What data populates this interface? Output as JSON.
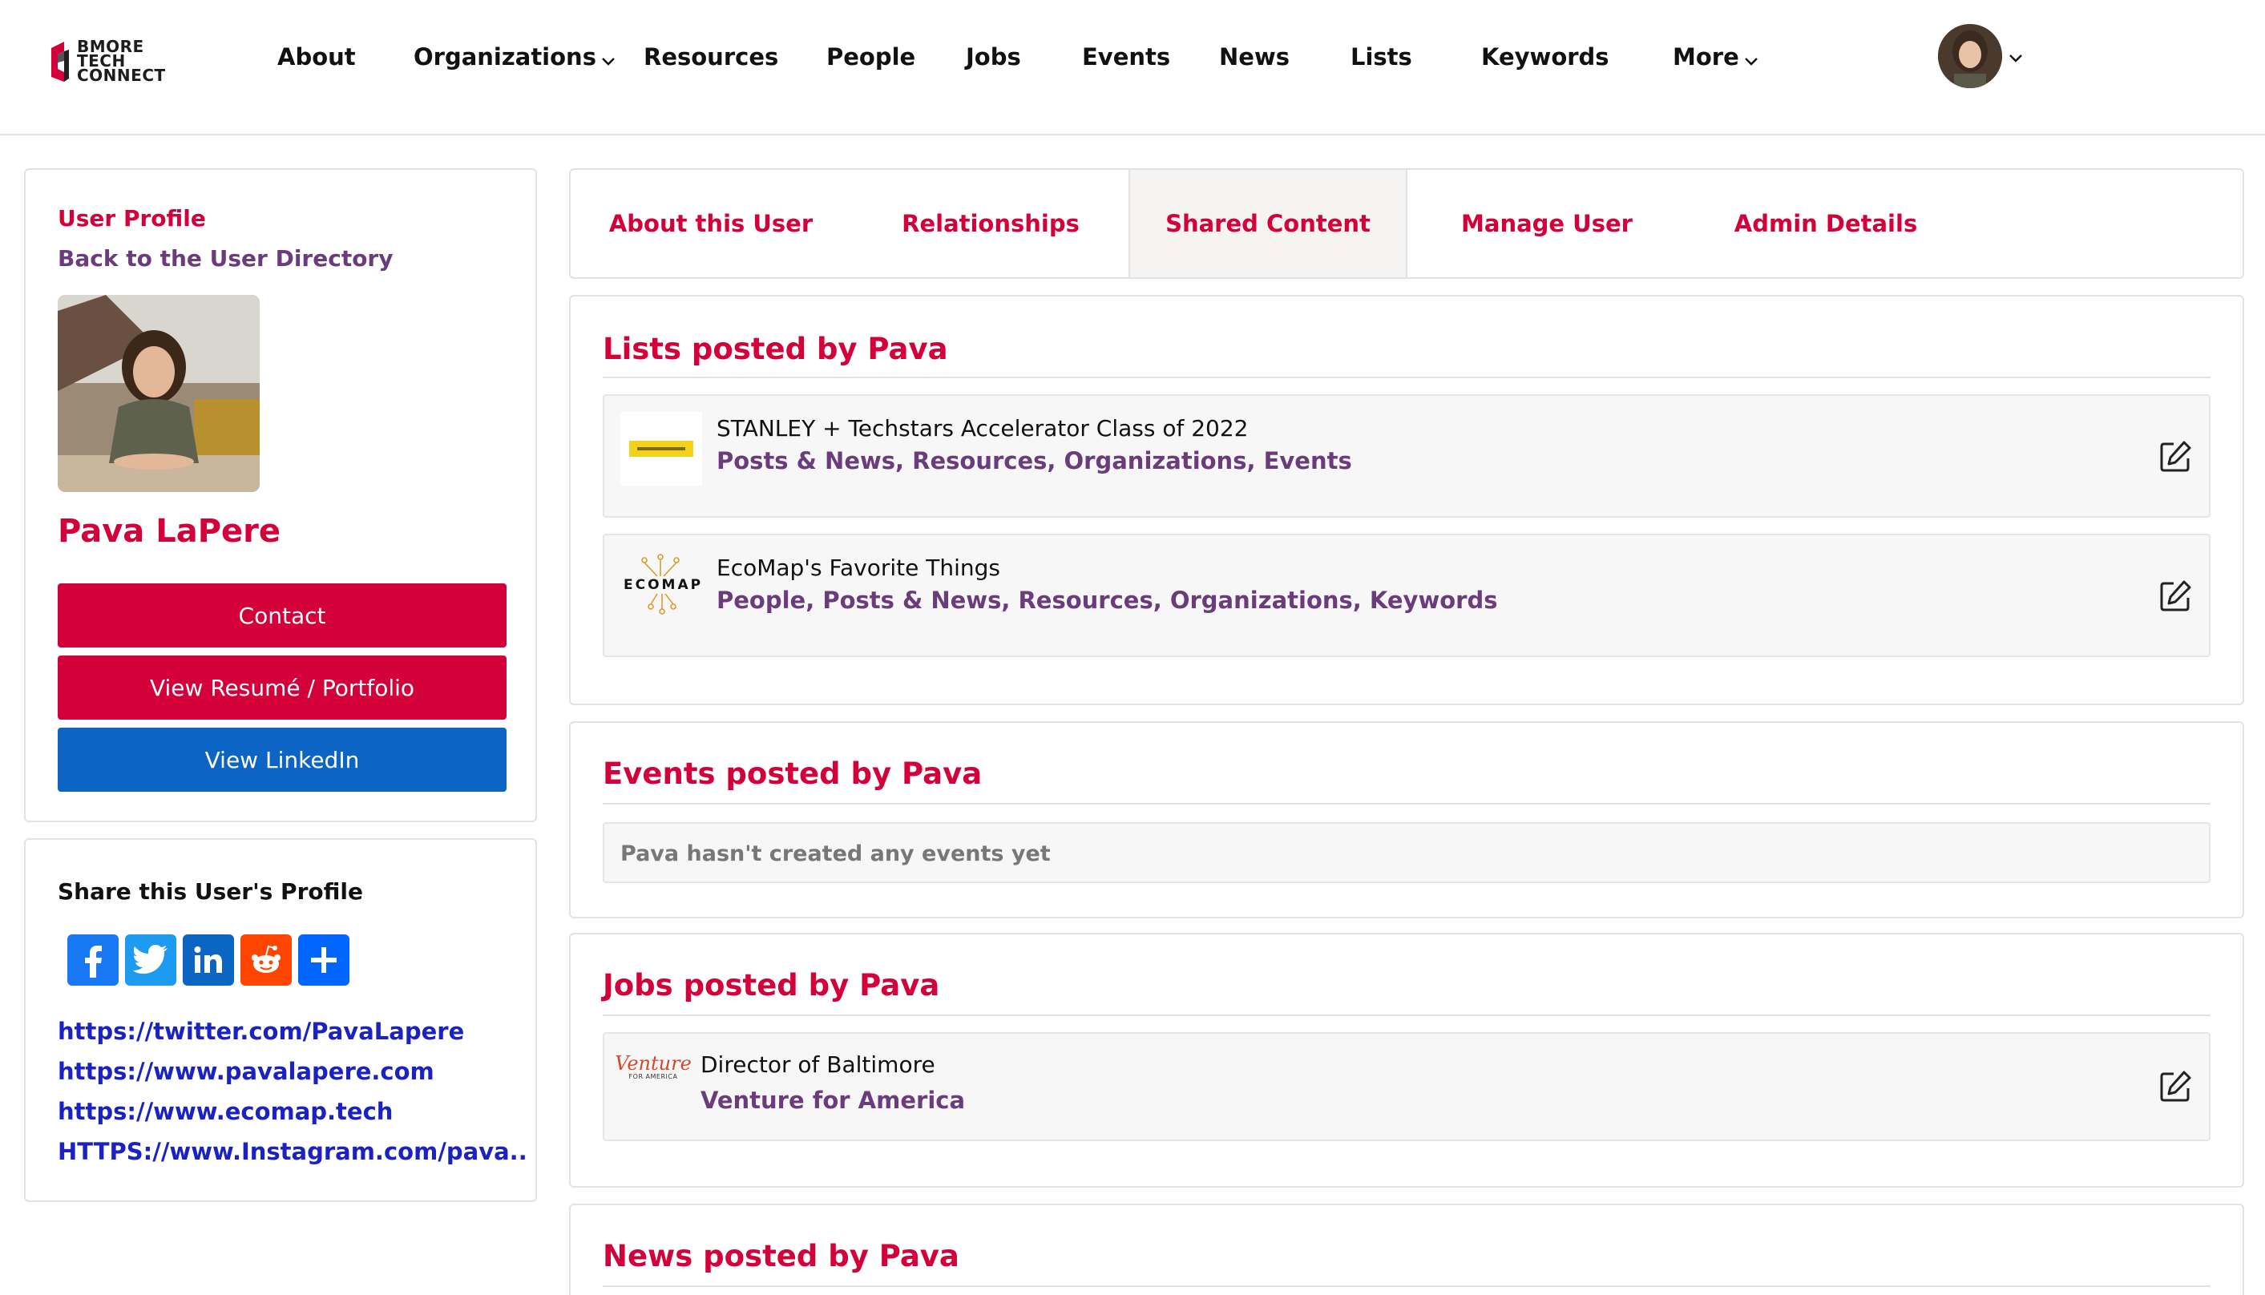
{
  "brand": {
    "logo_lines": [
      "BMORE",
      "TECH",
      "CONNECT"
    ],
    "accent": "#d4003a",
    "link_purple": "#6b3c7c",
    "linkedin_blue": "#0c64c4"
  },
  "nav": {
    "items": [
      {
        "label": "About"
      },
      {
        "label": "Organizations",
        "dropdown": true
      },
      {
        "label": "Resources"
      },
      {
        "label": "People"
      },
      {
        "label": "Jobs"
      },
      {
        "label": "Events"
      },
      {
        "label": "News"
      },
      {
        "label": "Lists"
      },
      {
        "label": "Keywords"
      },
      {
        "label": "More",
        "dropdown": true
      }
    ],
    "avatar_icon": "user-avatar"
  },
  "profile": {
    "section_label": "User Profile",
    "back_link": "Back to the User Directory",
    "name": "Pava LaPere",
    "buttons": {
      "contact": "Contact",
      "resume": "View Resumé / Portfolio",
      "linkedin": "View LinkedIn"
    }
  },
  "share": {
    "title": "Share this User's Profile",
    "icons": [
      "facebook-icon",
      "twitter-icon",
      "linkedin-icon",
      "reddit-icon",
      "share-plus-icon"
    ],
    "links": [
      "https://twitter.com/PavaLapere",
      "https://www.pavalapere.com",
      "https://www.ecomap.tech",
      "HTTPS://www.Instagram.com/pava.."
    ]
  },
  "tabs": {
    "items": [
      {
        "label": "About this User",
        "active": false
      },
      {
        "label": "Relationships",
        "active": false
      },
      {
        "label": "Shared Content",
        "active": true
      },
      {
        "label": "Manage User",
        "active": false
      },
      {
        "label": "Admin Details",
        "active": false
      }
    ]
  },
  "lists_section": {
    "title": "Lists posted by Pava",
    "items": [
      {
        "name": "STANLEY + Techstars Accelerator Class of 2022",
        "tags": "Posts & News, Resources, Organizations, Events",
        "thumb": "stanley-techstars-logo"
      },
      {
        "name": "EcoMap's Favorite Things",
        "tags": "People, Posts & News, Resources, Organizations, Keywords",
        "thumb": "ecomap-logo",
        "thumb_text": "ECOMAP"
      }
    ]
  },
  "events_section": {
    "title": "Events posted by Pava",
    "empty": "Pava hasn't created any events yet"
  },
  "jobs_section": {
    "title": "Jobs posted by Pava",
    "items": [
      {
        "name": "Director of Baltimore",
        "org": "Venture for America",
        "thumb": "venture-for-america-logo",
        "thumb_text": "Venture",
        "thumb_subtext": "FOR AMERICA"
      }
    ]
  },
  "news_section": {
    "title": "News posted by Pava"
  }
}
